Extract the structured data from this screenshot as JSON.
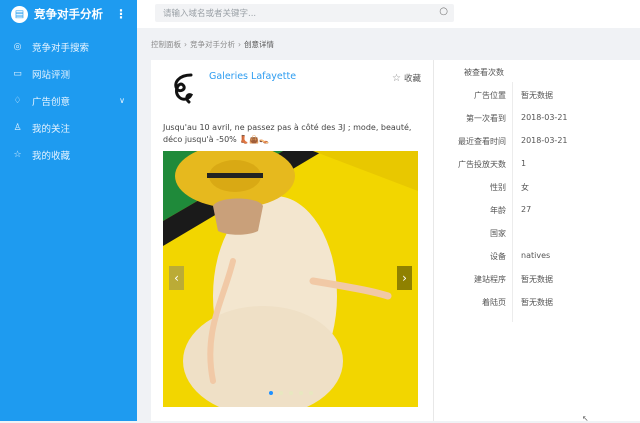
{
  "app": {
    "title": "竞争对手分析",
    "more": "⋮"
  },
  "sidebar": {
    "items": [
      {
        "label": "竞争对手搜索",
        "icon": "target-icon"
      },
      {
        "label": "网站评测",
        "icon": "monitor-icon"
      },
      {
        "label": "广告创意",
        "icon": "lightbulb-icon",
        "has_children": true
      },
      {
        "label": "我的关注",
        "icon": "user-icon"
      },
      {
        "label": "我的收藏",
        "icon": "star-icon"
      }
    ]
  },
  "search": {
    "placeholder": "请输入域名或者关键字..."
  },
  "breadcrumb": [
    "控制面板",
    "竞争对手分析",
    "创意详情"
  ],
  "ad": {
    "advertiser": "Galeries Lafayette",
    "favorite_label": "收藏",
    "text": "Jusqu'au 10 avril, ne passez pas à côté des 3J ; mode, beauté, déco jusqu'à -50% 👢👜👡",
    "slides": 5,
    "active_slide": 1
  },
  "details": [
    {
      "k": "被查看次数",
      "v": ""
    },
    {
      "k": "广告位置",
      "v": "暂无数据"
    },
    {
      "k": "第一次看到",
      "v": "2018-03-21"
    },
    {
      "k": "最近查看时间",
      "v": "2018-03-21"
    },
    {
      "k": "广告投放天数",
      "v": "1"
    },
    {
      "k": "性别",
      "v": "女"
    },
    {
      "k": "年龄",
      "v": "27"
    },
    {
      "k": "国家",
      "v": ""
    },
    {
      "k": "设备",
      "v": "natives"
    },
    {
      "k": "建站程序",
      "v": "暂无数据"
    },
    {
      "k": "着陆页",
      "v": "暂无数据"
    }
  ],
  "colors": {
    "sidebar": "#1e9bf0",
    "accent": "#2d9cf0"
  }
}
